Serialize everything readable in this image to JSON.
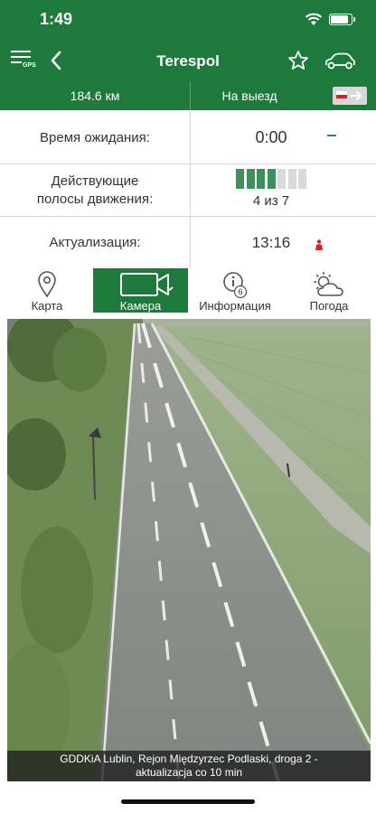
{
  "status": {
    "time": "1:49"
  },
  "nav": {
    "title": "Terespol",
    "gps_label": "GPS"
  },
  "strip": {
    "distance": "184.6 км",
    "direction": "На выезд"
  },
  "info": {
    "wait_label": "Время ожидания:",
    "wait_value": "0:00",
    "lanes_label_1": "Действующие",
    "lanes_label_2": "полосы движения:",
    "lanes_value": "4 из 7",
    "lanes_active": 4,
    "lanes_total": 7,
    "update_label": "Актуализация:",
    "update_value": "13:16"
  },
  "tabs": [
    {
      "label": "Карта",
      "icon": "map-pin-icon"
    },
    {
      "label": "Камера",
      "icon": "camera-icon",
      "active": true
    },
    {
      "label": "Информация",
      "icon": "info-icon",
      "badge": "6"
    },
    {
      "label": "Погода",
      "icon": "weather-icon"
    }
  ],
  "camera": {
    "caption_1": "GDDKiA Lublin, Rejon Międzyrzec Podlaski, droga 2 -",
    "caption_2": "aktualizacja co 10 min"
  },
  "colors": {
    "brand_green": "#1d7a3c",
    "lane_active": "#3f8f5a",
    "lane_inactive": "#d9d9d9",
    "accent_blue": "#2b76c8",
    "alert_red": "#d2232a"
  }
}
